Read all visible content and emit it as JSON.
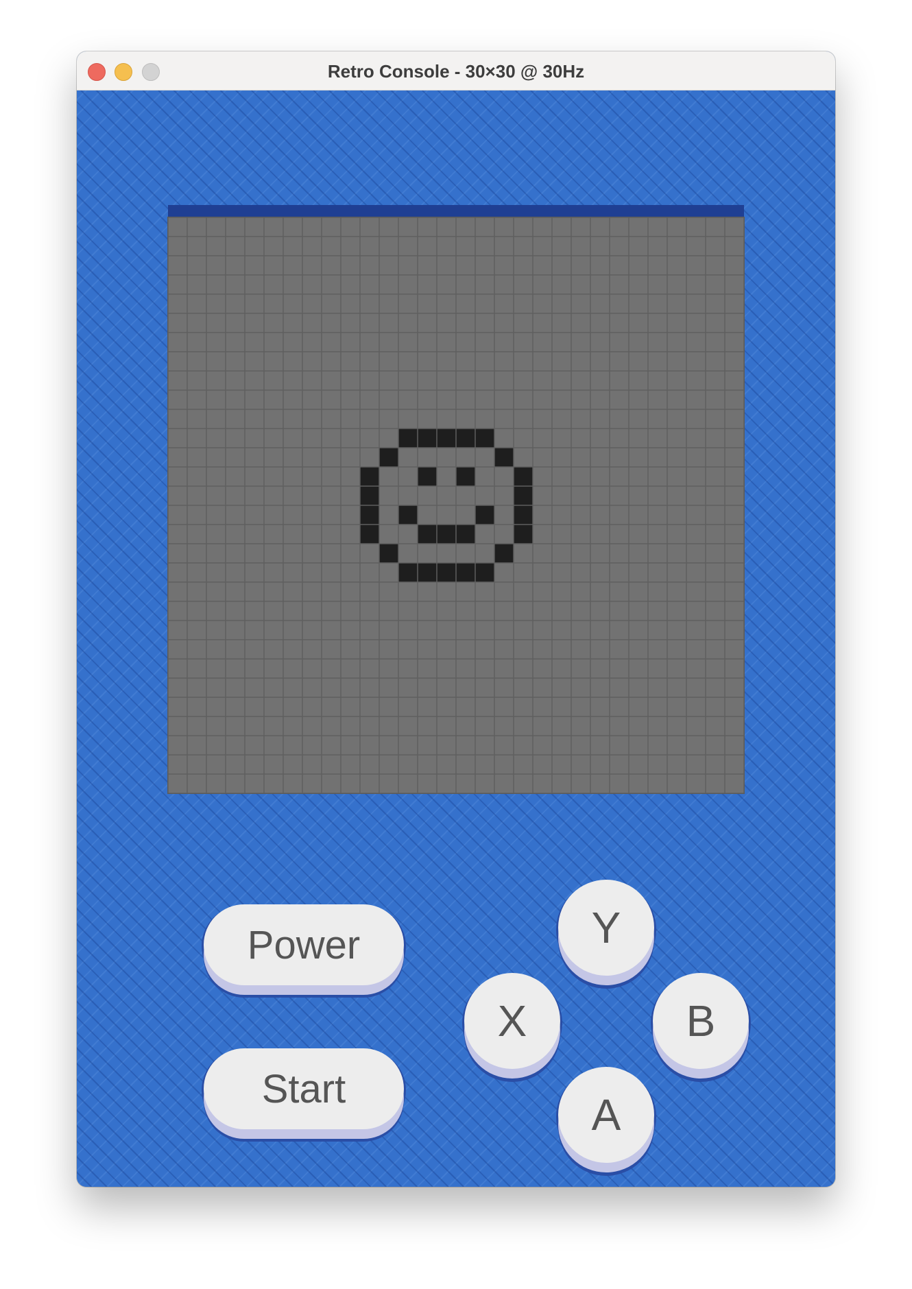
{
  "window": {
    "title": "Retro Console - 30×30 @ 30Hz"
  },
  "colors": {
    "body": "#3571cc",
    "screen_header": "#1f3f93",
    "screen_bg": "#727272",
    "grid_line": "#5f5f5f",
    "pixel_on": "#1e1e1e",
    "button_face": "#ededed",
    "button_text": "#555555"
  },
  "display": {
    "columns": 30,
    "rows": 30,
    "refresh_hz": 30,
    "lit_pixels": [
      [
        12,
        11
      ],
      [
        13,
        11
      ],
      [
        14,
        11
      ],
      [
        15,
        11
      ],
      [
        16,
        11
      ],
      [
        11,
        12
      ],
      [
        17,
        12
      ],
      [
        10,
        13
      ],
      [
        13,
        13
      ],
      [
        15,
        13
      ],
      [
        18,
        13
      ],
      [
        10,
        14
      ],
      [
        18,
        14
      ],
      [
        10,
        15
      ],
      [
        12,
        15
      ],
      [
        16,
        15
      ],
      [
        18,
        15
      ],
      [
        10,
        16
      ],
      [
        13,
        16
      ],
      [
        14,
        16
      ],
      [
        15,
        16
      ],
      [
        18,
        16
      ],
      [
        11,
        17
      ],
      [
        17,
        17
      ],
      [
        12,
        18
      ],
      [
        13,
        18
      ],
      [
        14,
        18
      ],
      [
        15,
        18
      ],
      [
        16,
        18
      ]
    ]
  },
  "buttons": {
    "power": "Power",
    "start": "Start",
    "y": "Y",
    "x": "X",
    "b": "B",
    "a": "A"
  }
}
